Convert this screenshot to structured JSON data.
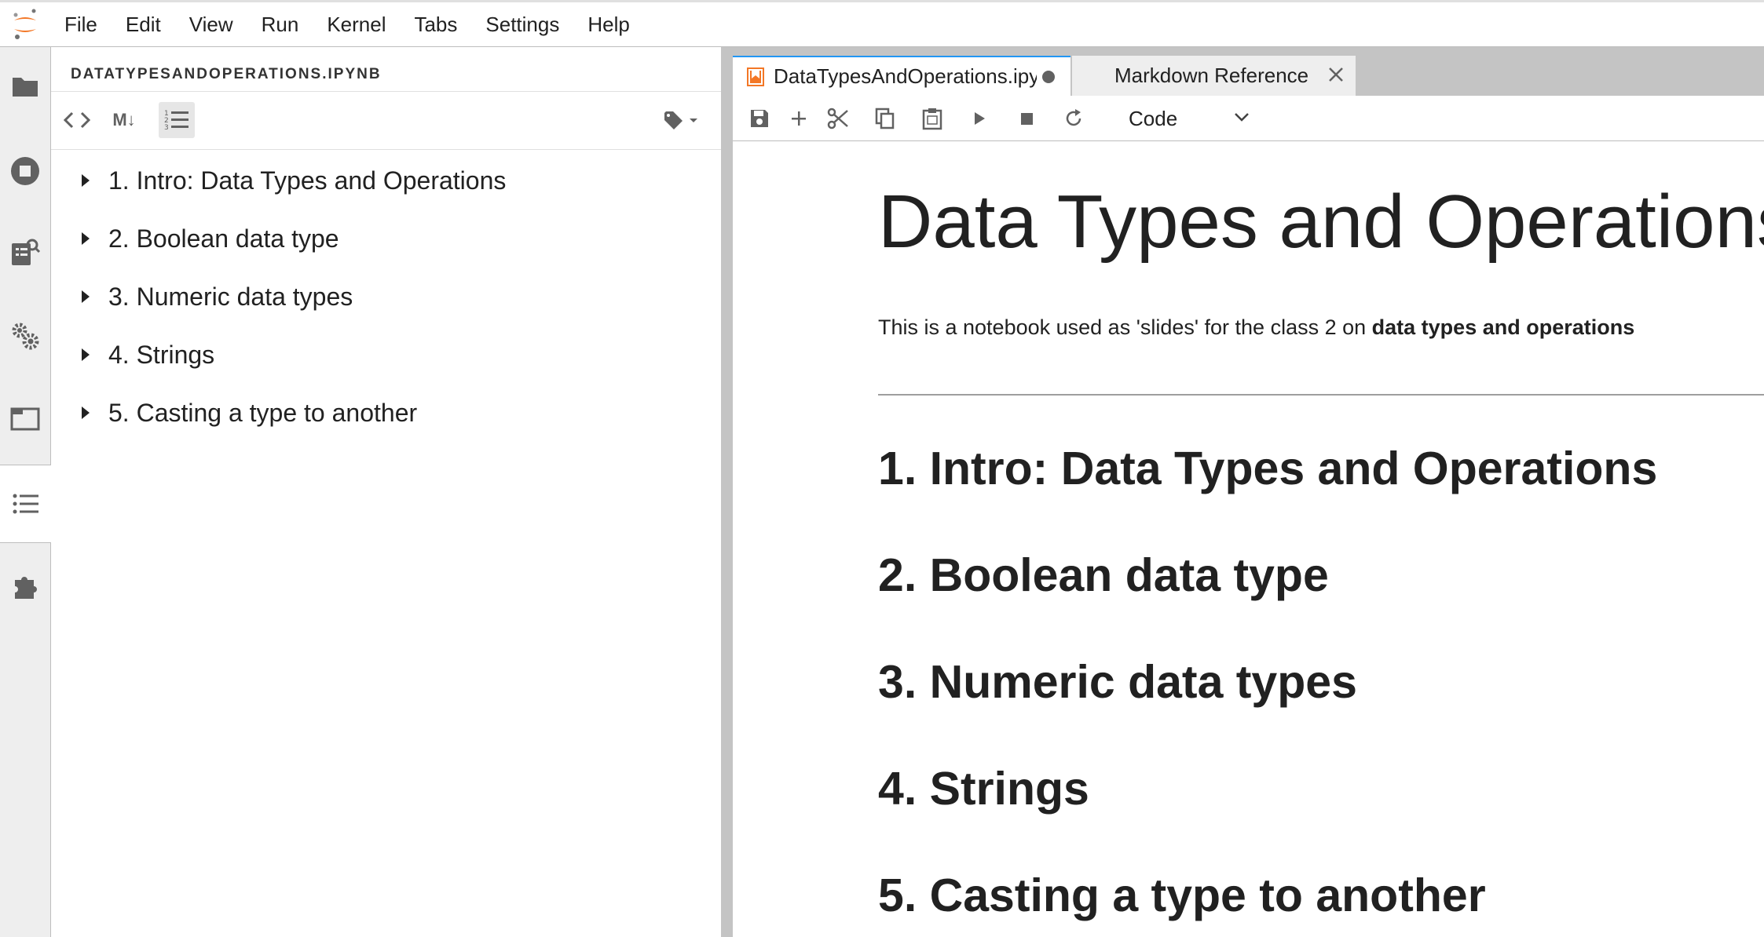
{
  "menubar": {
    "items": [
      "File",
      "Edit",
      "View",
      "Run",
      "Kernel",
      "Tabs",
      "Settings",
      "Help"
    ]
  },
  "activity": {
    "icons": [
      "folder-icon",
      "running-icon",
      "property-inspector-icon",
      "commands-icon",
      "tabs-icon",
      "toc-icon",
      "extension-icon"
    ],
    "active": "toc-icon"
  },
  "toc": {
    "title": "DATATYPESANDOPERATIONS.IPYNB",
    "toolbar": {
      "code_icon": "code-icon",
      "markdown_label": "M↓",
      "numbering_icon": "numbered-list-icon",
      "tag_icon": "tag-icon"
    },
    "items": [
      "1. Intro: Data Types and Operations",
      "2. Boolean data type",
      "3. Numeric data types",
      "4. Strings",
      "5. Casting a type to another"
    ]
  },
  "tabs": {
    "active": {
      "label": "DataTypesAndOperations.ipynb",
      "dirty": true
    },
    "inactive": {
      "label": "Markdown Reference"
    }
  },
  "notebook_toolbar": {
    "icons": [
      "save-icon",
      "add-icon",
      "cut-icon",
      "copy-icon",
      "paste-icon",
      "run-icon",
      "stop-icon",
      "restart-icon"
    ],
    "cell_type": "Code"
  },
  "notebook": {
    "title": "Data Types and Operations",
    "intro_text": "This is a notebook used as 'slides' for the class 2 on ",
    "intro_bold": "data types and operations",
    "headings": [
      "1. Intro: Data Types and Operations",
      "2. Boolean data type",
      "3. Numeric data types",
      "4. Strings",
      "5. Casting a type to another"
    ]
  },
  "colors": {
    "accent": "#f37726",
    "active_tab_border": "#2196f3",
    "icon_gray": "#616161",
    "panel_gray": "#eeeeee"
  }
}
